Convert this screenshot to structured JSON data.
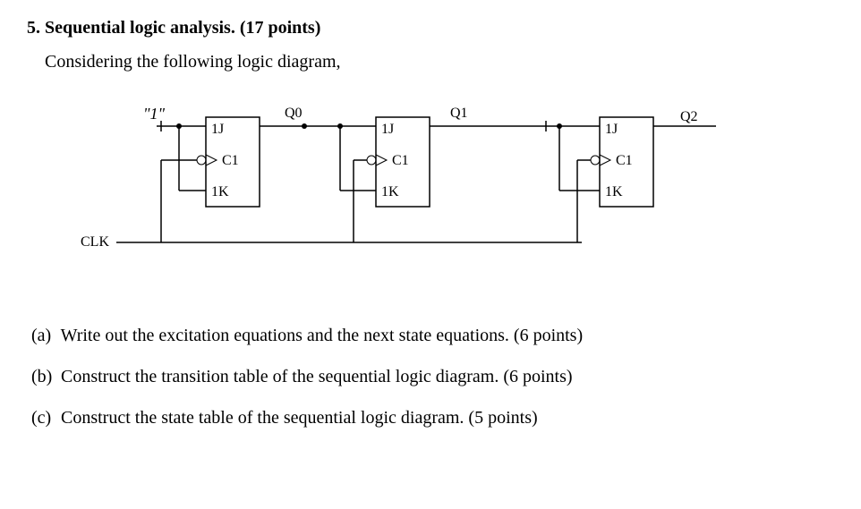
{
  "title": "5. Sequential logic analysis. (17 points)",
  "subtitle": "Considering the following logic diagram,",
  "diagram": {
    "constant_label": "\"1\"",
    "clk_label": "CLK",
    "ff_labels": {
      "j": "1J",
      "c": "C1",
      "k": "1K"
    },
    "outputs": {
      "q0": "Q0",
      "q1": "Q1",
      "q2": "Q2"
    }
  },
  "questions": [
    {
      "label": "(a)",
      "text": "Write out the excitation equations and the next state equations. (6 points)"
    },
    {
      "label": "(b)",
      "text": "Construct the transition table of the sequential logic diagram. (6 points)"
    },
    {
      "label": "(c)",
      "text": "Construct the state table of the sequential logic diagram. (5 points)"
    }
  ]
}
